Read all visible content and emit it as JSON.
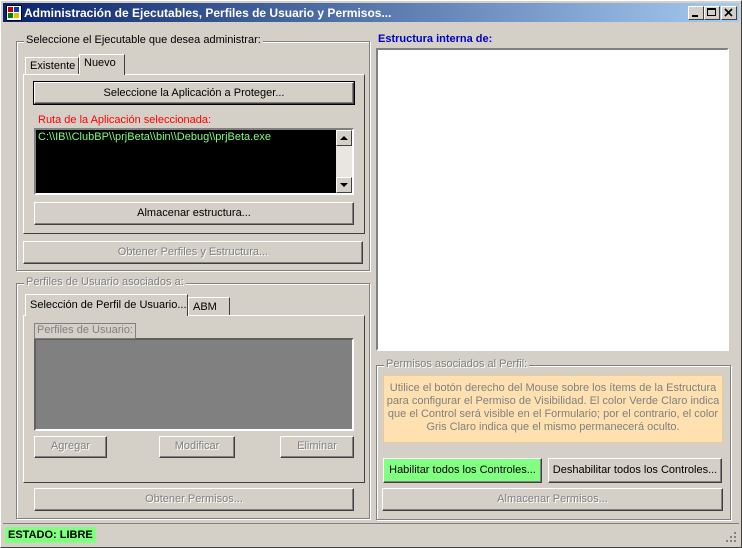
{
  "window": {
    "title": "Administración de Ejecutables, Perfiles de Usuario y Permisos..."
  },
  "exe_group": {
    "legend": "Seleccione el Ejecutable que desea administrar:",
    "tabs": [
      {
        "label": "Existente",
        "active": false
      },
      {
        "label": "Nuevo",
        "active": true
      }
    ],
    "select_button": "Seleccione la Aplicación a Proteger...",
    "path_label": "Ruta de la Aplicación seleccionada:",
    "path_value": "C:\\\\IB\\\\ClubBP\\\\prjBeta\\\\bin\\\\Debug\\\\prjBeta.exe",
    "store_button": "Almacenar estructura...",
    "profiles_button": "Obtener Perfiles y Estructura..."
  },
  "profiles_group": {
    "legend": "Perfiles de Usuario asociados a:",
    "tabs": [
      {
        "label": "Selección de Perfil de Usuario...",
        "active": true
      },
      {
        "label": "ABM",
        "active": false
      }
    ],
    "list_legend": "Perfiles de Usuario:",
    "add_button": "Agregar",
    "modify_button": "Modificar",
    "delete_button": "Eliminar",
    "permissions_button": "Obtener Permisos..."
  },
  "structure": {
    "title": "Estructura interna de:"
  },
  "permissions_group": {
    "legend": "Permisos asociados al Perfil:",
    "info": "Utilice el botón derecho del Mouse sobre los ítems de la Estructura para configurar el Permiso de Visibilidad. El color Verde Claro indica que el Control será visible en el Formulario; por el contrario, el color Gris Claro indica que el mismo permanecerá oculto.",
    "enable_button": "Habilitar todos los Controles...",
    "disable_button": "Deshabilitar todos los Controles...",
    "store_button": "Almacenar Permisos..."
  },
  "status": {
    "text": "ESTADO: LIBRE"
  },
  "colors": {
    "title_start": "#0a246a",
    "title_end": "#a6caf0",
    "status_bg": "#80ff80",
    "enable_bg": "#80ff80",
    "info_bg": "#ffe0b0",
    "path_fg": "#80ff80",
    "path_label": "#ff0000",
    "structure_title": "#0000c0"
  }
}
